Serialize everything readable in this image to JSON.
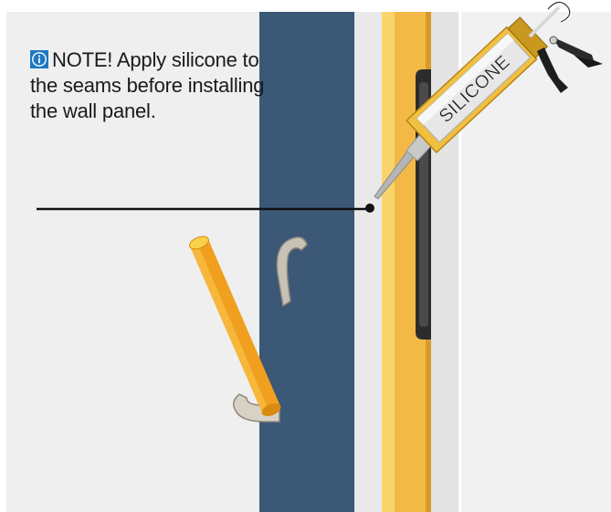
{
  "note": {
    "icon": "info-icon",
    "text": "NOTE! Apply silicone to the seams before installing the wall panel."
  },
  "tube_label": "SILICONE",
  "colors": {
    "background": "#efefef",
    "dark_panel": "#3b5877",
    "yellow_strip": "#f3b947",
    "info_blue": "#1e78c2",
    "rod_orange": "#f0a01e"
  }
}
